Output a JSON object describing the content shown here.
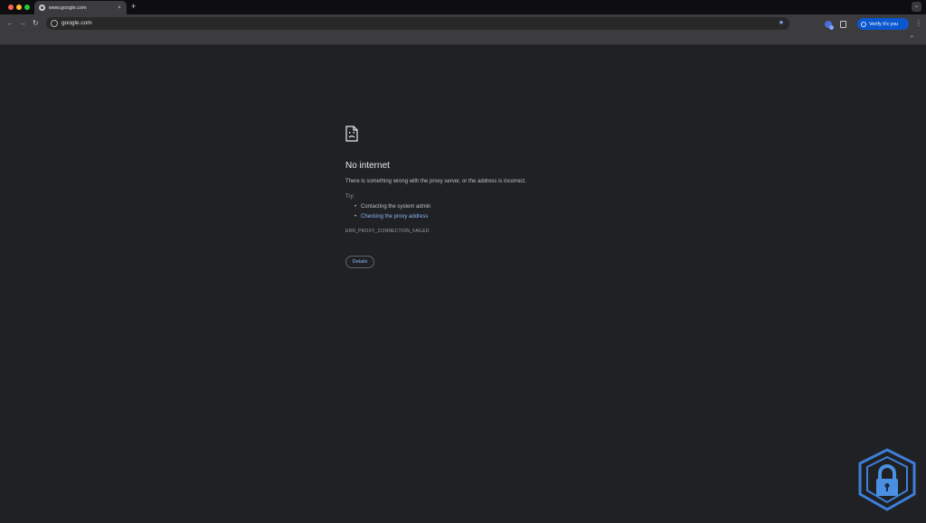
{
  "window": {
    "tab_title": "www.google.com",
    "tab_close": "×",
    "new_tab": "+",
    "tab_search": "⌄"
  },
  "toolbar": {
    "back": "←",
    "forward": "→",
    "reload": "↻",
    "url": "google.com",
    "bookmark_star": "★",
    "verify_label": "Verify it's you",
    "menu": "⋮"
  },
  "bookmarks": {
    "overflow": "»"
  },
  "error_page": {
    "title": "No internet",
    "description": "There is something wrong with the proxy server, or the address is incorrect.",
    "try_label": "Try:",
    "suggestions": [
      "Contacting the system admin",
      "Checking the proxy address"
    ],
    "error_code": "ERR_PROXY_CONNECTION_FAILED",
    "details_label": "Details"
  },
  "colors": {
    "page_bg": "#202124",
    "toolbar_bg": "#3c3c3f",
    "accent_blue": "#0b57d0",
    "link_blue": "#8ab4f8"
  },
  "icons": {
    "error": "sad-page-icon",
    "watermark": "shield-lock-icon"
  }
}
